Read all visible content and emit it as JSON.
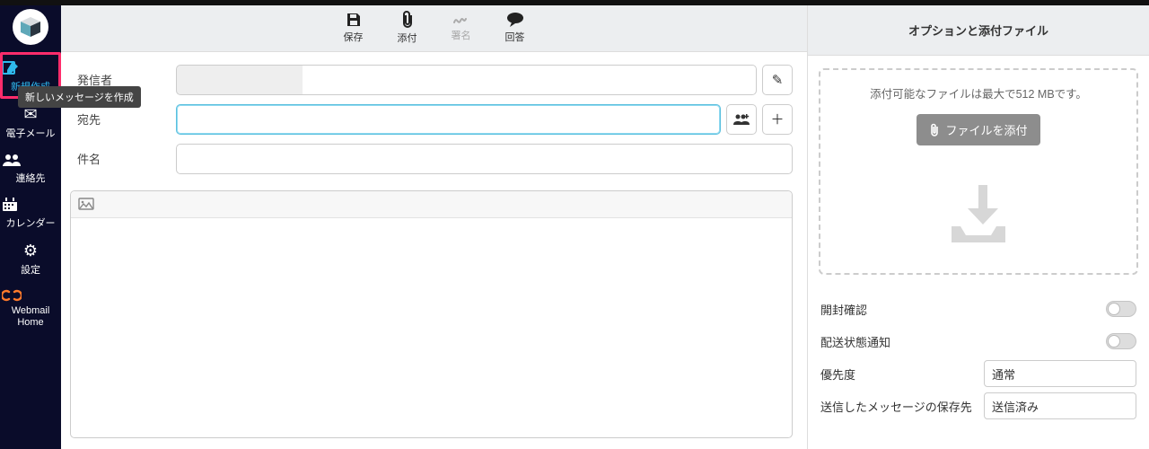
{
  "sidebar": {
    "items": [
      {
        "label": "新規作成"
      },
      {
        "label": "電子メール"
      },
      {
        "label": "連絡先"
      },
      {
        "label": "カレンダー"
      },
      {
        "label": "設定"
      },
      {
        "label": "Webmail Home"
      }
    ],
    "tooltip": "新しいメッセージを作成"
  },
  "toolbar": {
    "save": "保存",
    "attach": "添付",
    "signature": "署名",
    "reply": "回答"
  },
  "form": {
    "from_label": "発信者",
    "to_label": "宛先",
    "subject_label": "件名"
  },
  "right": {
    "title": "オプションと添付ファイル",
    "max_hint": "添付可能なファイルは最大で512 MBです。",
    "attach_btn": "ファイルを添付",
    "opt_read_receipt": "開封確認",
    "opt_delivery_status": "配送状態通知",
    "opt_priority": "優先度",
    "opt_priority_value": "通常",
    "opt_save_sent": "送信したメッセージの保存先",
    "opt_save_sent_value": "送信済み"
  }
}
